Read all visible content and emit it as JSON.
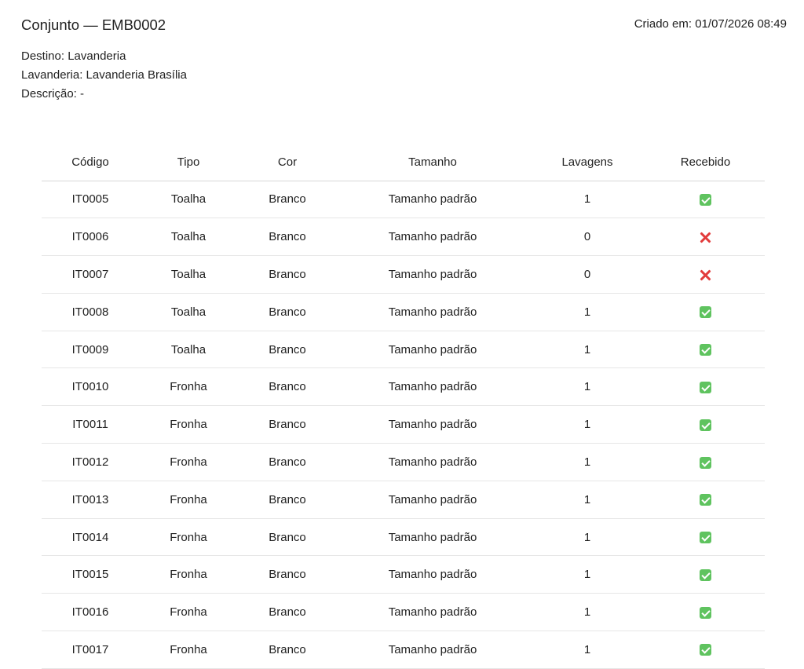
{
  "header": {
    "title": "Conjunto — EMB0002",
    "created": "Criado em: 01/07/2026 08:49"
  },
  "meta": {
    "destino": "Destino: Lavanderia",
    "lavanderia": "Lavanderia: Lavanderia Brasília",
    "descricao": "Descrição: -"
  },
  "table": {
    "columns": [
      "Código",
      "Tipo",
      "Cor",
      "Tamanho",
      "Lavagens",
      "Recebido"
    ],
    "rows": [
      {
        "codigo": "IT0005",
        "tipo": "Toalha",
        "cor": "Branco",
        "tamanho": "Tamanho padrão",
        "lavagens": "1",
        "recebido": "check-icon"
      },
      {
        "codigo": "IT0006",
        "tipo": "Toalha",
        "cor": "Branco",
        "tamanho": "Tamanho padrão",
        "lavagens": "0",
        "recebido": "cross-icon"
      },
      {
        "codigo": "IT0007",
        "tipo": "Toalha",
        "cor": "Branco",
        "tamanho": "Tamanho padrão",
        "lavagens": "0",
        "recebido": "cross-icon"
      },
      {
        "codigo": "IT0008",
        "tipo": "Toalha",
        "cor": "Branco",
        "tamanho": "Tamanho padrão",
        "lavagens": "1",
        "recebido": "check-icon"
      },
      {
        "codigo": "IT0009",
        "tipo": "Toalha",
        "cor": "Branco",
        "tamanho": "Tamanho padrão",
        "lavagens": "1",
        "recebido": "check-icon"
      },
      {
        "codigo": "IT0010",
        "tipo": "Fronha",
        "cor": "Branco",
        "tamanho": "Tamanho padrão",
        "lavagens": "1",
        "recebido": "check-icon"
      },
      {
        "codigo": "IT0011",
        "tipo": "Fronha",
        "cor": "Branco",
        "tamanho": "Tamanho padrão",
        "lavagens": "1",
        "recebido": "check-icon"
      },
      {
        "codigo": "IT0012",
        "tipo": "Fronha",
        "cor": "Branco",
        "tamanho": "Tamanho padrão",
        "lavagens": "1",
        "recebido": "check-icon"
      },
      {
        "codigo": "IT0013",
        "tipo": "Fronha",
        "cor": "Branco",
        "tamanho": "Tamanho padrão",
        "lavagens": "1",
        "recebido": "check-icon"
      },
      {
        "codigo": "IT0014",
        "tipo": "Fronha",
        "cor": "Branco",
        "tamanho": "Tamanho padrão",
        "lavagens": "1",
        "recebido": "check-icon"
      },
      {
        "codigo": "IT0015",
        "tipo": "Fronha",
        "cor": "Branco",
        "tamanho": "Tamanho padrão",
        "lavagens": "1",
        "recebido": "check-icon"
      },
      {
        "codigo": "IT0016",
        "tipo": "Fronha",
        "cor": "Branco",
        "tamanho": "Tamanho padrão",
        "lavagens": "1",
        "recebido": "check-icon"
      },
      {
        "codigo": "IT0017",
        "tipo": "Fronha",
        "cor": "Branco",
        "tamanho": "Tamanho padrão",
        "lavagens": "1",
        "recebido": "check-icon"
      }
    ]
  }
}
